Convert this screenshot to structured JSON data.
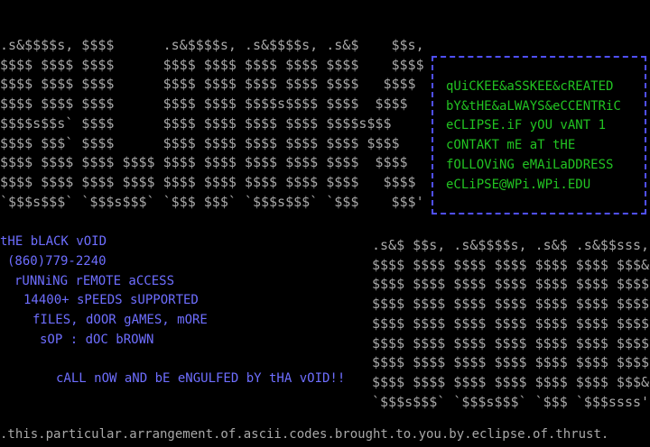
{
  "ascii_art": {
    "top": [
      ".s&$$$$s, $$$$      .s&$$$$s, .s&$$$$s, .s&$    $$s,",
      "$$$$ $$$$ $$$$      $$$$ $$$$ $$$$ $$$$ $$$$    $$$$",
      "$$$$ $$$$ $$$$      $$$$ $$$$ $$$$ $$$$ $$$$   $$$$",
      "$$$$ $$$$ $$$$      $$$$ $$$$ $$$$s$$$$ $$$$  $$$$",
      "$$$$s$$s` $$$$      $$$$ $$$$ $$$$ $$$$ $$$$s$$$",
      "$$$$ $$$` $$$$      $$$$ $$$$ $$$$ $$$$ $$$$ $$$$",
      "$$$$ $$$$ $$$$ $$$$ $$$$ $$$$ $$$$ $$$$ $$$$  $$$$",
      "$$$$ $$$$ $$$$ $$$$ $$$$ $$$$ $$$$ $$$$ $$$$   $$$$",
      "`$$$s$$$` `$$$s$$$` `$$$ $$$` `$$$s$$$` `$$$    $$$'"
    ],
    "bottom": [
      ".s&$ $$s, .s&$$$$s, .s&$ .s&$$sss,",
      "$$$$ $$$$ $$$$ $$$$ $$$$ $$$$ $$$&",
      "$$$$ $$$$ $$$$ $$$$ $$$$ $$$$ $$$$",
      "$$$$ $$$$ $$$$ $$$$ $$$$ $$$$ $$$$",
      "$$$$ $$$$ $$$$ $$$$ $$$$ $$$$ $$$$",
      "$$$$ $$$$ $$$$ $$$$ $$$$ $$$$ $$$$",
      "$$$$ $$$$ $$$$ $$$$ $$$$ $$$$ $$$$",
      "$$$$ $$$$ $$$$ $$$$ $$$$ $$$$ $$$&",
      "`$$$s$$$` `$$$s$$$` `$$$ `$$$ssss'"
    ]
  },
  "credit_box": {
    "lines": [
      "qUiCKEE&aSSKEE&cREATED",
      "bY&tHE&aLWAYS&eCCENTRiC",
      "eCLIPSE.iF yOU vANT 1",
      "cONTAKT mE aT tHE",
      "fOLLOViNG eMAiLaDDRESS",
      "eCLiPSE@WPi.WPi.EDU"
    ]
  },
  "bbs_info": {
    "lines": [
      "tHE bLACK vOID",
      "(860)779-2240",
      "rUNNiNG rEMOTE aCCESS",
      "14400+ sPEEDS sUPPORTED",
      "fILES, dOOR gAMES, mORE",
      "sOP : dOC bROWN",
      "cALL nOW aND bE eNGULFED bY tHA vOID!!"
    ]
  },
  "footer_text": ".this.particular.arrangement.of.ascii.codes.brought.to.you.by.eclipse.of.thrust.",
  "colors": {
    "background": "#000000",
    "ascii_gray": "#a8a8a8",
    "box_border_blue": "#5050ff",
    "box_text_green": "#22c322",
    "info_text_blue": "#6e6eff"
  }
}
